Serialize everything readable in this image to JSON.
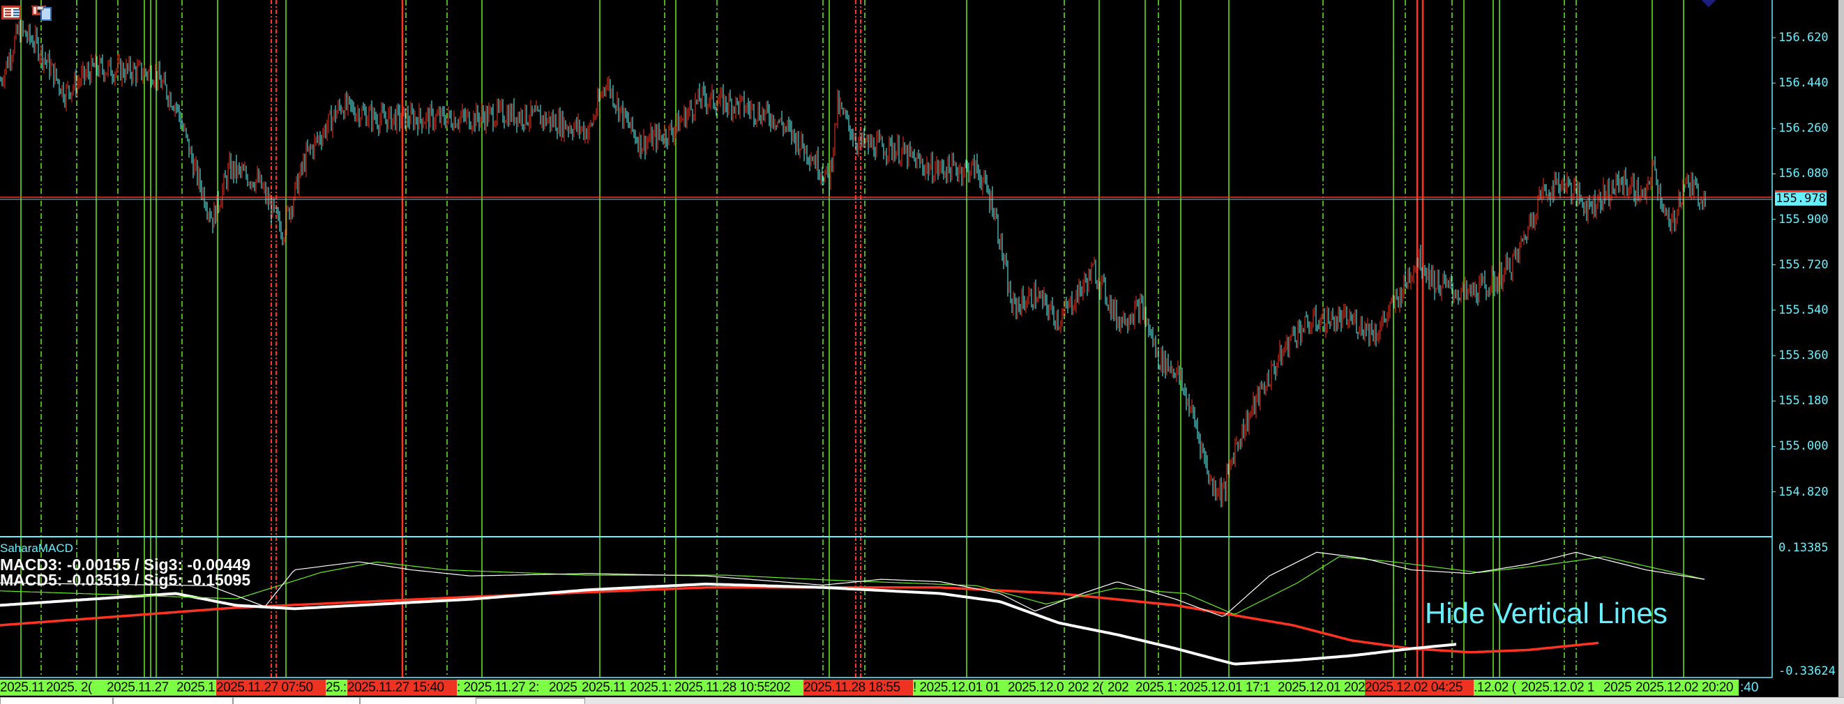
{
  "toolbar": {
    "icons": [
      "chart-list-icon",
      "save-template-icon"
    ]
  },
  "price_axis": {
    "labels": [
      "156.620",
      "156.440",
      "156.260",
      "156.080",
      "155.900",
      "155.720",
      "155.540",
      "155.360",
      "155.180",
      "155.000",
      "154.820"
    ],
    "values": [
      156.62,
      156.44,
      156.26,
      156.08,
      155.9,
      155.72,
      155.54,
      155.36,
      155.18,
      155.0,
      154.82
    ],
    "current_price": "155.978",
    "current_value": 155.978
  },
  "indicator": {
    "name": "SaharaMACD",
    "line1": "MACD3: -0.00155 / Sig3: -0.00449",
    "line2": "MACD5: -0.03519 / Sig5: -0.15095",
    "axis_max_label": "0.13385",
    "axis_min_label": "-0.33624",
    "axis_max": 0.13385,
    "axis_min": -0.33624
  },
  "hide_button": {
    "label": "Hide Vertical Lines"
  },
  "time_axis": {
    "labels": [
      {
        "text": "2025.11",
        "color": "green"
      },
      {
        "text": "2025. 2(",
        "color": "green"
      },
      {
        "text": "2025.11.27",
        "color": "green"
      },
      {
        "text": "2025.1",
        "color": "green"
      },
      {
        "text": "2025.11.27 07:50",
        "color": "red"
      },
      {
        "text": "25.:",
        "color": "green"
      },
      {
        "text": "2025.11.27 15:40",
        "color": "red"
      },
      {
        "text": ": 2025.11.27 2:",
        "color": "green"
      },
      {
        "text": "2025",
        "color": "green"
      },
      {
        "text": "2025.11",
        "color": "green"
      },
      {
        "text": "2025.1:",
        "color": "green"
      },
      {
        "text": "2025.11.28 10:55",
        "color": "green"
      },
      {
        "text": "202",
        "color": "green"
      },
      {
        "text": "2025.11.28 18:55",
        "color": "red"
      },
      {
        "text": "! 2025.12.01 01",
        "color": "green"
      },
      {
        "text": "2025.12.0",
        "color": "green"
      },
      {
        "text": "202 2(",
        "color": "green"
      },
      {
        "text": "202",
        "color": "green"
      },
      {
        "text": "2025.1:",
        "color": "green"
      },
      {
        "text": "2025.12.01 17:1",
        "color": "green"
      },
      {
        "text": "2025.12.01 202",
        "color": "green"
      },
      {
        "text": "2025.12.02 04:25",
        "color": "red"
      },
      {
        "text": ".12.02 (",
        "color": "green"
      },
      {
        "text": "2025.12.02 1",
        "color": "green"
      },
      {
        "text": "2025",
        "color": "green"
      },
      {
        "text": "2025.12.02 20:20",
        "color": "green"
      }
    ],
    "tail": ":40"
  },
  "colors": {
    "up": "#ff3322",
    "down": "#66ffff",
    "axis": "#66f0ff",
    "green_label": "#7cff44",
    "red_label": "#ee3322"
  },
  "chart_data": {
    "type": "candlestick",
    "price_path": [
      [
        0,
        156.45
      ],
      [
        13,
        156.65
      ],
      [
        25,
        156.6
      ],
      [
        46,
        156.4
      ],
      [
        67,
        156.5
      ],
      [
        110,
        156.48
      ],
      [
        126,
        156.35
      ],
      [
        139,
        156.1
      ],
      [
        152,
        155.9
      ],
      [
        164,
        156.1
      ],
      [
        185,
        156.05
      ],
      [
        202,
        155.85
      ],
      [
        219,
        156.15
      ],
      [
        244,
        156.35
      ],
      [
        270,
        156.3
      ],
      [
        295,
        156.3
      ],
      [
        337,
        156.3
      ],
      [
        362,
        156.32
      ],
      [
        388,
        156.3
      ],
      [
        422,
        156.25
      ],
      [
        434,
        156.45
      ],
      [
        447,
        156.3
      ],
      [
        459,
        156.2
      ],
      [
        481,
        156.25
      ],
      [
        502,
        156.38
      ],
      [
        531,
        156.35
      ],
      [
        556,
        156.3
      ],
      [
        582,
        156.15
      ],
      [
        594,
        156.05
      ],
      [
        600,
        156.35
      ],
      [
        615,
        156.2
      ],
      [
        641,
        156.18
      ],
      [
        666,
        156.1
      ],
      [
        700,
        156.1
      ],
      [
        712,
        155.95
      ],
      [
        725,
        155.55
      ],
      [
        742,
        155.6
      ],
      [
        759,
        155.5
      ],
      [
        784,
        155.7
      ],
      [
        801,
        155.5
      ],
      [
        818,
        155.55
      ],
      [
        830,
        155.35
      ],
      [
        843,
        155.3
      ],
      [
        856,
        155.1
      ],
      [
        868,
        154.85
      ],
      [
        877,
        154.82
      ],
      [
        885,
        155.0
      ],
      [
        902,
        155.2
      ],
      [
        927,
        155.45
      ],
      [
        944,
        155.5
      ],
      [
        969,
        155.5
      ],
      [
        986,
        155.45
      ],
      [
        1003,
        155.6
      ],
      [
        1016,
        155.75
      ],
      [
        1028,
        155.65
      ],
      [
        1050,
        155.6
      ],
      [
        1071,
        155.65
      ],
      [
        1087,
        155.75
      ],
      [
        1104,
        156.0
      ],
      [
        1121,
        156.05
      ],
      [
        1138,
        155.95
      ],
      [
        1163,
        156.05
      ],
      [
        1180,
        155.98
      ],
      [
        1184,
        156.12
      ],
      [
        1197,
        155.85
      ],
      [
        1207,
        156.05
      ],
      [
        1222,
        155.978
      ]
    ],
    "macd5": [
      [
        0,
        -0.085
      ],
      [
        126,
        -0.04
      ],
      [
        169,
        -0.085
      ],
      [
        211,
        -0.098
      ],
      [
        337,
        -0.062
      ],
      [
        422,
        -0.026
      ],
      [
        506,
        -0.004
      ],
      [
        590,
        -0.017
      ],
      [
        674,
        -0.04
      ],
      [
        717,
        -0.071
      ],
      [
        759,
        -0.152
      ],
      [
        801,
        -0.197
      ],
      [
        843,
        -0.25
      ],
      [
        885,
        -0.309
      ],
      [
        927,
        -0.295
      ],
      [
        969,
        -0.277
      ],
      [
        1012,
        -0.25
      ],
      [
        1045,
        -0.233
      ]
    ],
    "sig5": [
      [
        0,
        -0.161
      ],
      [
        169,
        -0.094
      ],
      [
        337,
        -0.053
      ],
      [
        506,
        -0.017
      ],
      [
        674,
        -0.017
      ],
      [
        759,
        -0.04
      ],
      [
        843,
        -0.085
      ],
      [
        927,
        -0.161
      ],
      [
        969,
        -0.219
      ],
      [
        1012,
        -0.25
      ],
      [
        1054,
        -0.264
      ],
      [
        1096,
        -0.255
      ],
      [
        1147,
        -0.228
      ]
    ],
    "macd3": [
      [
        0,
        0.0
      ],
      [
        150,
        -0.01
      ],
      [
        190,
        -0.09
      ],
      [
        211,
        0.05
      ],
      [
        257,
        0.081
      ],
      [
        295,
        0.05
      ],
      [
        337,
        0.027
      ],
      [
        422,
        0.036
      ],
      [
        506,
        0.027
      ],
      [
        590,
        -0.008
      ],
      [
        632,
        0.014
      ],
      [
        674,
        0.005
      ],
      [
        717,
        -0.04
      ],
      [
        742,
        -0.107
      ],
      [
        776,
        -0.04
      ],
      [
        801,
        0.005
      ],
      [
        843,
        -0.062
      ],
      [
        877,
        -0.129
      ],
      [
        910,
        0.027
      ],
      [
        944,
        0.117
      ],
      [
        978,
        0.094
      ],
      [
        1012,
        0.05
      ],
      [
        1054,
        0.036
      ],
      [
        1096,
        0.072
      ],
      [
        1130,
        0.117
      ],
      [
        1180,
        0.05
      ],
      [
        1222,
        0.014
      ]
    ],
    "sig3": [
      [
        0,
        -0.03
      ],
      [
        170,
        -0.06
      ],
      [
        230,
        0.04
      ],
      [
        270,
        0.08
      ],
      [
        320,
        0.05
      ],
      [
        420,
        0.03
      ],
      [
        520,
        0.03
      ],
      [
        600,
        0.01
      ],
      [
        700,
        -0.01
      ],
      [
        750,
        -0.08
      ],
      [
        800,
        -0.02
      ],
      [
        850,
        -0.04
      ],
      [
        885,
        -0.12
      ],
      [
        930,
        0.0
      ],
      [
        960,
        0.1
      ],
      [
        1000,
        0.08
      ],
      [
        1060,
        0.04
      ],
      [
        1110,
        0.07
      ],
      [
        1150,
        0.1
      ],
      [
        1222,
        0.014
      ]
    ]
  }
}
